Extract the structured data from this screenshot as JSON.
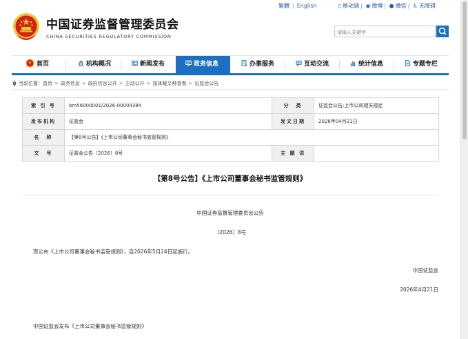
{
  "top_links": {
    "traditional": "繁體",
    "english": "English",
    "mobile": "移动端",
    "weibo": "微博",
    "wechat": "微信",
    "accessibility": "无障碍"
  },
  "header": {
    "title_cn": "中国证券监督管理委员会",
    "title_en": "CHINA SECURITIES REGULATORY COMMISSION",
    "search_placeholder": "请输入关键字"
  },
  "nav": {
    "items": [
      {
        "label": "首页"
      },
      {
        "label": "机构概况"
      },
      {
        "label": "新闻发布"
      },
      {
        "label": "政务信息"
      },
      {
        "label": "办事服务"
      },
      {
        "label": "互动交流"
      },
      {
        "label": "统计信息"
      },
      {
        "label": "专题专栏"
      }
    ],
    "active": "政务信息"
  },
  "breadcrumb": {
    "prefix": "当前位置：",
    "items": [
      "首页",
      "政务信息",
      "政府信息公开",
      "主动公开",
      "按体裁文种查看",
      "证监会公告"
    ]
  },
  "meta": {
    "index_label": "索 引 号",
    "index_value": "bm56000001/2026-00004384",
    "category_label": "分　类",
    "category_value": "证监会公告;上市公司相关规定",
    "publisher_label": "发布机构",
    "publisher_value": "证监会",
    "date_label": "发文日期",
    "date_value": "2026年04月21日",
    "name_label": "名　称",
    "name_value": "【第8号公告】《上市公司董事会秘书监管规则》",
    "doc_label": "文　号",
    "doc_value": "证监会公告〔2026〕8号",
    "subject_label": "主 题 词",
    "subject_value": ""
  },
  "article": {
    "title": "【第8号公告】《上市公司董事会秘书监管规则》",
    "issuer_heading": "中国证券监督管理委员会公告",
    "number": "〔2026〕8号",
    "body": "现公布《上市公司董事会秘书监管规则》，自2026年5月24日起施行。",
    "signature": "中国证监会",
    "sign_date": "2026年4月21日",
    "attachment": "中国证监会发布《上市公司董事会秘书监管规则》"
  },
  "colors": {
    "brand_blue": "#1d6fc4",
    "emblem_red": "#d0241b",
    "emblem_gold": "#f2c230"
  }
}
